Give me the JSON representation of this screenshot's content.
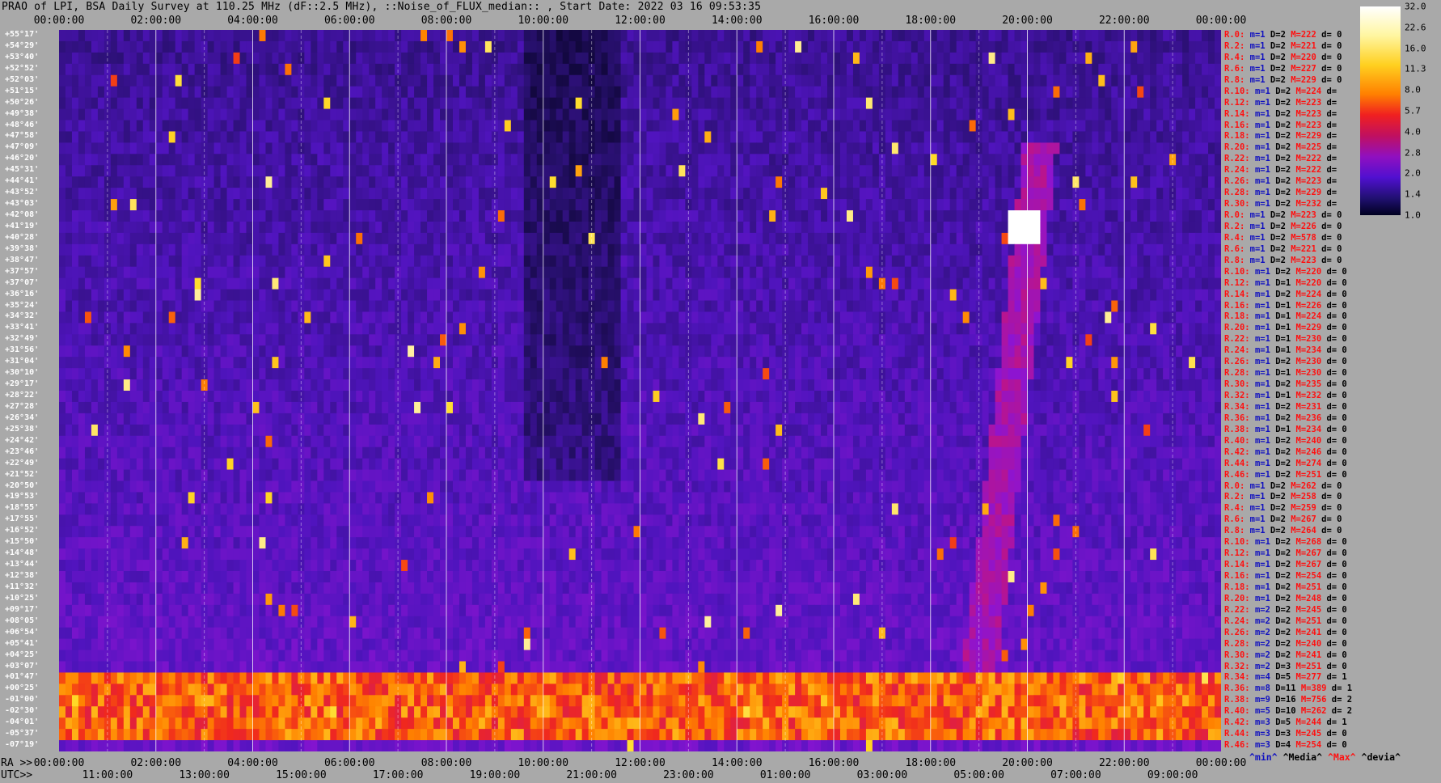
{
  "title": "PRAO of LPI, BSA Daily Survey at 110.25 MHz (dF::2.5 MHz), ::Noise_of_FLUX_median:: , Start Date: 2022 03 16 09:53:35",
  "top_ticks": [
    "00:00:00",
    "02:00:00",
    "04:00:00",
    "06:00:00",
    "08:00:00",
    "10:00:00",
    "12:00:00",
    "14:00:00",
    "16:00:00",
    "18:00:00",
    "20:00:00",
    "22:00:00",
    "00:00:00"
  ],
  "ra_prefix": "RA >>",
  "ra_ticks": [
    "00:00:00",
    "02:00:00",
    "04:00:00",
    "06:00:00",
    "08:00:00",
    "10:00:00",
    "12:00:00",
    "14:00:00",
    "16:00:00",
    "18:00:00",
    "20:00:00",
    "22:00:00",
    "00:00:00"
  ],
  "utc_prefix": "UTC>>",
  "utc_ticks": [
    "11:00:00",
    "13:00:00",
    "15:00:00",
    "17:00:00",
    "19:00:00",
    "21:00:00",
    "23:00:00",
    "01:00:00",
    "03:00:00",
    "05:00:00",
    "07:00:00",
    "09:00:00"
  ],
  "declinations": [
    "+55°17'",
    "+54°29'",
    "+53°40'",
    "+52°52'",
    "+52°03'",
    "+51°15'",
    "+50°26'",
    "+49°38'",
    "+48°46'",
    "+47°58'",
    "+47°09'",
    "+46°20'",
    "+45°31'",
    "+44°41'",
    "+43°52'",
    "+43°03'",
    "+42°08'",
    "+41°19'",
    "+40°28'",
    "+39°38'",
    "+38°47'",
    "+37°57'",
    "+37°07'",
    "+36°16'",
    "+35°24'",
    "+34°32'",
    "+33°41'",
    "+32°49'",
    "+31°56'",
    "+31°04'",
    "+30°10'",
    "+29°17'",
    "+28°22'",
    "+27°28'",
    "+26°34'",
    "+25°38'",
    "+24°42'",
    "+23°46'",
    "+22°49'",
    "+21°52'",
    "+20°50'",
    "+19°53'",
    "+18°55'",
    "+17°55'",
    "+16°52'",
    "+15°50'",
    "+14°48'",
    "+13°44'",
    "+12°38'",
    "+11°32'",
    "+10°25'",
    "+09°17'",
    "+08°05'",
    "+06°54'",
    "+05°41'",
    "+04°25'",
    "+03°07'",
    "+01°47'",
    "+00°25'",
    "-01°00'",
    "-02°30'",
    "-04°01'",
    "-05°37'",
    "-07°19'"
  ],
  "stats": [
    [
      "R.0:",
      "m=1",
      "D=2",
      "M=222",
      "d= 0"
    ],
    [
      "R.2:",
      "m=1",
      "D=2",
      "M=221",
      "d= 0"
    ],
    [
      "R.4:",
      "m=1",
      "D=2",
      "M=220",
      "d= 0"
    ],
    [
      "R.6:",
      "m=1",
      "D=2",
      "M=227",
      "d= 0"
    ],
    [
      "R.8:",
      "m=1",
      "D=2",
      "M=229",
      "d= 0"
    ],
    [
      "R.10:",
      "m=1",
      "D=2",
      "M=224",
      "d="
    ],
    [
      "R.12:",
      "m=1",
      "D=2",
      "M=223",
      "d="
    ],
    [
      "R.14:",
      "m=1",
      "D=2",
      "M=223",
      "d="
    ],
    [
      "R.16:",
      "m=1",
      "D=2",
      "M=223",
      "d="
    ],
    [
      "R.18:",
      "m=1",
      "D=2",
      "M=229",
      "d="
    ],
    [
      "R.20:",
      "m=1",
      "D=2",
      "M=225",
      "d="
    ],
    [
      "R.22:",
      "m=1",
      "D=2",
      "M=222",
      "d="
    ],
    [
      "R.24:",
      "m=1",
      "D=2",
      "M=222",
      "d="
    ],
    [
      "R.26:",
      "m=1",
      "D=2",
      "M=223",
      "d="
    ],
    [
      "R.28:",
      "m=1",
      "D=2",
      "M=229",
      "d="
    ],
    [
      "R.30:",
      "m=1",
      "D=2",
      "M=232",
      "d="
    ],
    [
      "R.0:",
      "m=1",
      "D=2",
      "M=223",
      "d= 0"
    ],
    [
      "R.2:",
      "m=1",
      "D=2",
      "M=226",
      "d= 0"
    ],
    [
      "R.4:",
      "m=1",
      "D=2",
      "M=578",
      "d= 0"
    ],
    [
      "R.6:",
      "m=1",
      "D=2",
      "M=221",
      "d= 0"
    ],
    [
      "R.8:",
      "m=1",
      "D=2",
      "M=223",
      "d= 0"
    ],
    [
      "R.10:",
      "m=1",
      "D=2",
      "M=220",
      "d= 0"
    ],
    [
      "R.12:",
      "m=1",
      "D=1",
      "M=220",
      "d= 0"
    ],
    [
      "R.14:",
      "m=1",
      "D=2",
      "M=224",
      "d= 0"
    ],
    [
      "R.16:",
      "m=1",
      "D=1",
      "M=226",
      "d= 0"
    ],
    [
      "R.18:",
      "m=1",
      "D=1",
      "M=224",
      "d= 0"
    ],
    [
      "R.20:",
      "m=1",
      "D=1",
      "M=229",
      "d= 0"
    ],
    [
      "R.22:",
      "m=1",
      "D=1",
      "M=230",
      "d= 0"
    ],
    [
      "R.24:",
      "m=1",
      "D=1",
      "M=234",
      "d= 0"
    ],
    [
      "R.26:",
      "m=1",
      "D=2",
      "M=230",
      "d= 0"
    ],
    [
      "R.28:",
      "m=1",
      "D=1",
      "M=230",
      "d= 0"
    ],
    [
      "R.30:",
      "m=1",
      "D=2",
      "M=235",
      "d= 0"
    ],
    [
      "R.32:",
      "m=1",
      "D=1",
      "M=232",
      "d= 0"
    ],
    [
      "R.34:",
      "m=1",
      "D=2",
      "M=231",
      "d= 0"
    ],
    [
      "R.36:",
      "m=1",
      "D=2",
      "M=236",
      "d= 0"
    ],
    [
      "R.38:",
      "m=1",
      "D=1",
      "M=234",
      "d= 0"
    ],
    [
      "R.40:",
      "m=1",
      "D=2",
      "M=240",
      "d= 0"
    ],
    [
      "R.42:",
      "m=1",
      "D=2",
      "M=246",
      "d= 0"
    ],
    [
      "R.44:",
      "m=1",
      "D=2",
      "M=274",
      "d= 0"
    ],
    [
      "R.46:",
      "m=1",
      "D=2",
      "M=251",
      "d= 0"
    ],
    [
      "R.0:",
      "m=1",
      "D=2",
      "M=262",
      "d= 0"
    ],
    [
      "R.2:",
      "m=1",
      "D=2",
      "M=258",
      "d= 0"
    ],
    [
      "R.4:",
      "m=1",
      "D=2",
      "M=259",
      "d= 0"
    ],
    [
      "R.6:",
      "m=1",
      "D=2",
      "M=267",
      "d= 0"
    ],
    [
      "R.8:",
      "m=1",
      "D=2",
      "M=264",
      "d= 0"
    ],
    [
      "R.10:",
      "m=1",
      "D=2",
      "M=268",
      "d= 0"
    ],
    [
      "R.12:",
      "m=1",
      "D=2",
      "M=267",
      "d= 0"
    ],
    [
      "R.14:",
      "m=1",
      "D=2",
      "M=267",
      "d= 0"
    ],
    [
      "R.16:",
      "m=1",
      "D=2",
      "M=254",
      "d= 0"
    ],
    [
      "R.18:",
      "m=1",
      "D=2",
      "M=251",
      "d= 0"
    ],
    [
      "R.20:",
      "m=1",
      "D=2",
      "M=248",
      "d= 0"
    ],
    [
      "R.22:",
      "m=2",
      "D=2",
      "M=245",
      "d= 0"
    ],
    [
      "R.24:",
      "m=2",
      "D=2",
      "M=251",
      "d= 0"
    ],
    [
      "R.26:",
      "m=2",
      "D=2",
      "M=241",
      "d= 0"
    ],
    [
      "R.28:",
      "m=2",
      "D=2",
      "M=240",
      "d= 0"
    ],
    [
      "R.30:",
      "m=2",
      "D=2",
      "M=241",
      "d= 0"
    ],
    [
      "R.32:",
      "m=2",
      "D=3",
      "M=251",
      "d= 0"
    ],
    [
      "R.34:",
      "m=4",
      "D=5",
      "M=277",
      "d= 1"
    ],
    [
      "R.36:",
      "m=8",
      "D=11",
      "M=389",
      "d= 1"
    ],
    [
      "R.38:",
      "m=9",
      "D=16",
      "M=756",
      "d= 2"
    ],
    [
      "R.40:",
      "m=5",
      "D=10",
      "M=262",
      "d= 2"
    ],
    [
      "R.42:",
      "m=3",
      "D=5",
      "M=244",
      "d= 1"
    ],
    [
      "R.44:",
      "m=3",
      "D=3",
      "M=245",
      "d= 0"
    ],
    [
      "R.46:",
      "m=3",
      "D=4",
      "M=254",
      "d= 0"
    ]
  ],
  "legend_bottom": {
    "min": "^min^",
    "media": "^Media^",
    "max": "^Max^",
    "devia": "^devia^"
  },
  "colorbar_labels": [
    "32.0",
    "22.6",
    "16.0",
    "11.3",
    "8.0",
    "5.7",
    "4.0",
    "2.8",
    "2.0",
    "1.4",
    "1.0"
  ],
  "colors": {
    "background": "#a9a9a9",
    "stat_label": "#ff1010",
    "stat_min": "#1010c0"
  },
  "chart_data": {
    "type": "heatmap",
    "title": "PRAO of LPI, BSA Daily Survey at 110.25 MHz (dF::2.5 MHz), ::Noise_of_FLUX_median:: , Start Date: 2022 03 16 09:53:35",
    "x_axis": "RA (hours) with UTC secondary axis",
    "xlim": [
      0,
      24
    ],
    "y_rows": 64,
    "color_scale": "log",
    "clim": [
      1.0,
      32.0
    ],
    "features": [
      {
        "type": "band",
        "rows": [
          57,
          62
        ],
        "level": 16.0
      },
      {
        "type": "source",
        "ra": 19.9,
        "row": 17,
        "level": 32.0
      },
      {
        "type": "arc",
        "ra_start": 18.8,
        "ra_end": 20.2,
        "rows": [
          10,
          62
        ],
        "level": 5.7
      }
    ]
  }
}
